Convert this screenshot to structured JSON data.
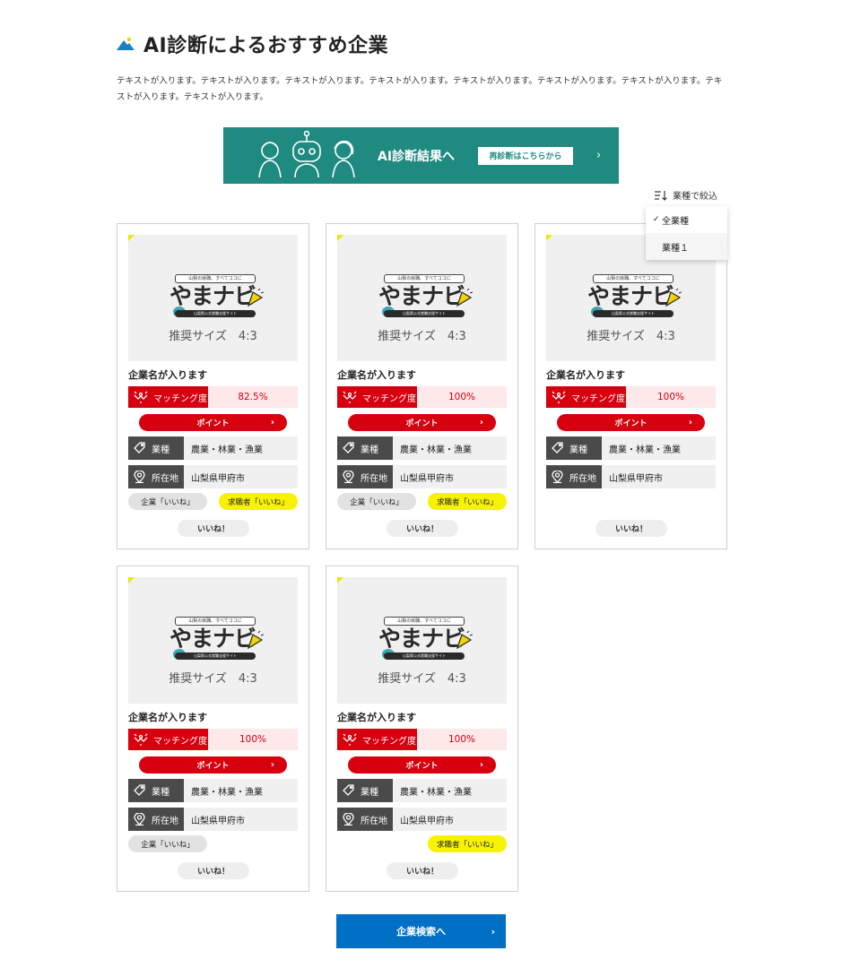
{
  "page": {
    "title": "AI診断によるおすすめ企業",
    "description": "テキストが入ります。テキストが入ります。テキストが入ります。テキストが入ります。テキストが入ります。テキストが入ります。テキストが入ります。テキストが入ります。テキストが入ります。"
  },
  "banner": {
    "title": "AI診断結果へ",
    "button_label": "再診断はこちらから",
    "chevron": "›"
  },
  "filter": {
    "label": "業種で絞込",
    "options": [
      {
        "label": "全業種",
        "selected": true
      },
      {
        "label": "業種１",
        "selected": false
      }
    ],
    "check": "✓"
  },
  "cards": [
    {
      "logo_tag": "山梨の就職、すべてココに",
      "logo_main": "やまナビ",
      "logo_sub": "山梨県公式就職支援サイト",
      "size_label": "推奨サイズ　4:3",
      "company": "企業名が入ります",
      "matching_label": "マッチング度",
      "matching_value": "82.5%",
      "point_label": "ポイント",
      "industry_label": "業種",
      "industry_value": "農業・林業・漁業",
      "location_label": "所在地",
      "location_value": "山梨県甲府市",
      "company_like": "企業「いいね」",
      "seeker_like": "求職者「いいね」",
      "like_button": "いいね！"
    },
    {
      "logo_tag": "山梨の就職、すべてココに",
      "logo_main": "やまナビ",
      "logo_sub": "山梨県公式就職支援サイト",
      "size_label": "推奨サイズ　4:3",
      "company": "企業名が入ります",
      "matching_label": "マッチング度",
      "matching_value": "100%",
      "point_label": "ポイント",
      "industry_label": "業種",
      "industry_value": "農業・林業・漁業",
      "location_label": "所在地",
      "location_value": "山梨県甲府市",
      "company_like": "企業「いいね」",
      "seeker_like": "求職者「いいね」",
      "like_button": "いいね！"
    },
    {
      "logo_tag": "山梨の就職、すべてココに",
      "logo_main": "やまナビ",
      "logo_sub": "山梨県公式就職支援サイト",
      "size_label": "推奨サイズ　4:3",
      "company": "企業名が入ります",
      "matching_label": "マッチング度",
      "matching_value": "100%",
      "point_label": "ポイント",
      "industry_label": "業種",
      "industry_value": "農業・林業・漁業",
      "location_label": "所在地",
      "location_value": "山梨県甲府市",
      "like_button": "いいね！"
    },
    {
      "logo_tag": "山梨の就職、すべてココに",
      "logo_main": "やまナビ",
      "logo_sub": "山梨県公式就職支援サイト",
      "size_label": "推奨サイズ　4:3",
      "company": "企業名が入ります",
      "matching_label": "マッチング度",
      "matching_value": "100%",
      "point_label": "ポイント",
      "industry_label": "業種",
      "industry_value": "農業・林業・漁業",
      "location_label": "所在地",
      "location_value": "山梨県甲府市",
      "company_like": "企業「いいね」",
      "like_button": "いいね！"
    },
    {
      "logo_tag": "山梨の就職、すべてココに",
      "logo_main": "やまナビ",
      "logo_sub": "山梨県公式就職支援サイト",
      "size_label": "推奨サイズ　4:3",
      "company": "企業名が入ります",
      "matching_label": "マッチング度",
      "matching_value": "100%",
      "point_label": "ポイント",
      "industry_label": "業種",
      "industry_value": "農業・林業・漁業",
      "location_label": "所在地",
      "location_value": "山梨県甲府市",
      "seeker_like": "求職者「いいね」",
      "like_button": "いいね！"
    }
  ],
  "search_button": {
    "label": "企業検索へ",
    "chevron": "›"
  },
  "colors": {
    "teal": "#1f8a80",
    "red": "#d6000f",
    "yellow": "#f7f200",
    "blue": "#0070c4"
  }
}
